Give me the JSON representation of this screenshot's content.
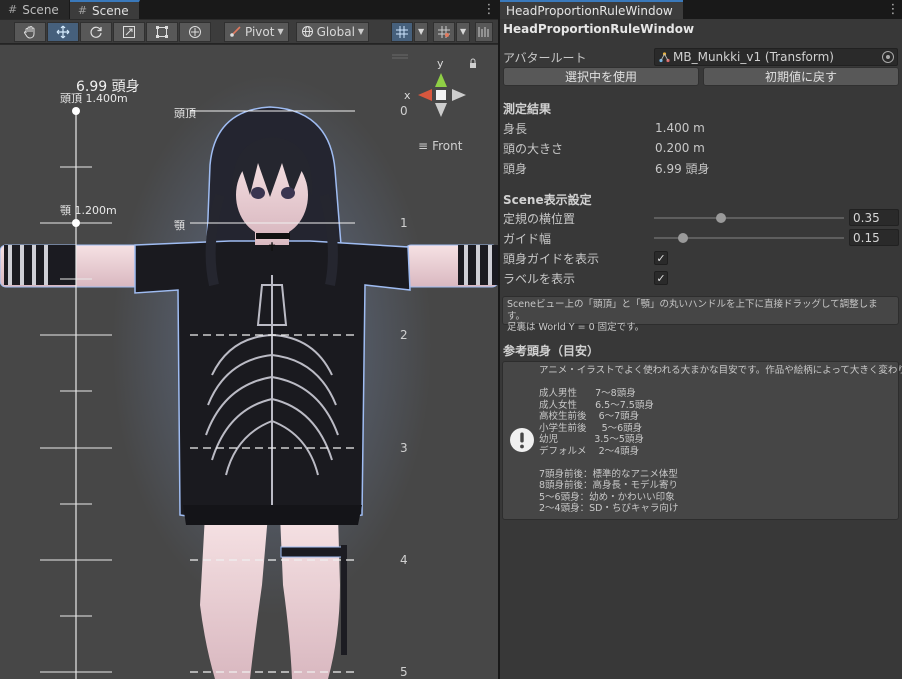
{
  "scene": {
    "tabs": [
      {
        "label": "Scene",
        "icon": "hash-icon",
        "active": false
      },
      {
        "label": "Scene",
        "icon": "hash-icon",
        "active": true
      }
    ],
    "toolbar": {
      "tools": [
        "hand-tool",
        "move-tool",
        "rotate-tool",
        "scale-tool",
        "rect-tool",
        "transform-tool"
      ],
      "pivot_label": "Pivot",
      "space_label": "Global"
    },
    "overlay": {
      "heads_value": "6.99 頭身",
      "top_label": "頭頂  1.400m",
      "chin_label": "顎  1.200m",
      "top_mark": "頭頂",
      "chin_mark": "顎",
      "ticks": [
        "0",
        "1",
        "2",
        "3",
        "4",
        "5"
      ],
      "gizmo_y": "y",
      "gizmo_x": "x",
      "view_label": "Front"
    }
  },
  "rule_window": {
    "tab_title": "HeadProportionRuleWindow",
    "window_title": "HeadProportionRuleWindow",
    "avatar_root_label": "アバタールート",
    "avatar_root_value": "MB_Munkki_v1 (Transform)",
    "use_selection_button": "選択中を使用",
    "reset_button": "初期値に戻す",
    "measure": {
      "heading": "測定結果",
      "rows": [
        {
          "label": "身長",
          "value": "1.400 m"
        },
        {
          "label": "頭の大きさ",
          "value": "0.200 m"
        },
        {
          "label": "頭身",
          "value": "6.99 頭身"
        }
      ]
    },
    "scene_settings": {
      "heading": "Scene表示設定",
      "ruler_pos_label": "定規の横位置",
      "ruler_pos_value": "0.35",
      "ruler_pos_fraction": 0.35,
      "guide_width_label": "ガイド幅",
      "guide_width_value": "0.15",
      "guide_width_fraction": 0.15,
      "show_head_guides_label": "頭身ガイドを表示",
      "show_head_guides": true,
      "show_labels_label": "ラベルを表示",
      "show_labels": true
    },
    "help1_lines": [
      "Sceneビュー上の「頭頂」と「顎」の丸いハンドルを上下に直接ドラッグして調整します。",
      "足裏は World Y = 0 固定です。"
    ],
    "reference": {
      "heading": "参考頭身（目安）",
      "icon": "info-exclamation-icon",
      "lines": [
        "アニメ・イラストでよく使われる大まかな目安です。作品や絵柄によって大きく変わります。",
        "",
        "成人男性      7～8頭身",
        "成人女性      6.5～7.5頭身",
        "高校生前後    6～7頭身",
        "小学生前後     5～6頭身",
        "幼児            3.5～5頭身",
        "デフォルメ    2～4頭身",
        "",
        "7頭身前後：標準的なアニメ体型",
        "8頭身前後：高身長・モデル寄り",
        "5～6頭身：幼め・かわいい印象",
        "2～4頭身：SD・ちびキャラ向け"
      ]
    }
  }
}
